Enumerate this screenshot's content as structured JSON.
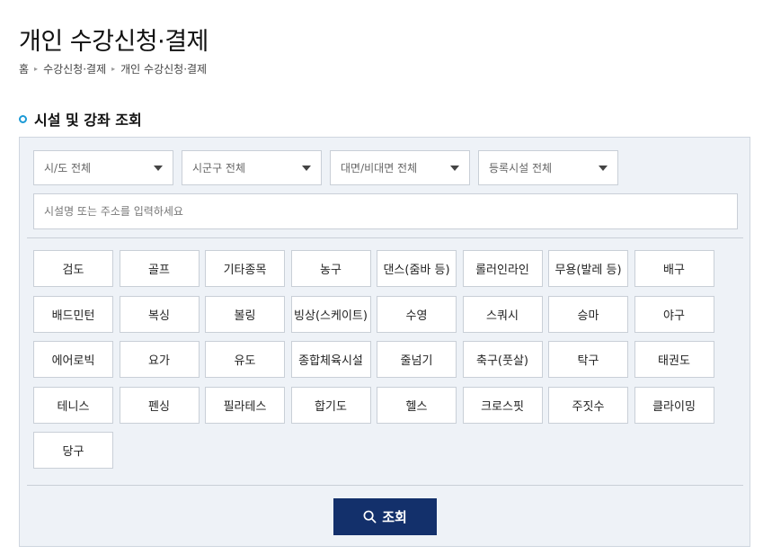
{
  "page": {
    "title": "개인 수강신청·결제"
  },
  "breadcrumb": {
    "items": [
      "홈",
      "수강신청·결제",
      "개인 수강신청·결제"
    ]
  },
  "section": {
    "title": "시설 및 강좌 조회"
  },
  "filters": {
    "selects": [
      "시/도 전체",
      "시군구 전체",
      "대면/비대면 전체",
      "등록시설 전체"
    ],
    "search_placeholder": "시설명 또는 주소를 입력하세요"
  },
  "sports": [
    "검도",
    "골프",
    "기타종목",
    "농구",
    "댄스(줌바 등)",
    "롤러인라인",
    "무용(발레 등)",
    "배구",
    "배드민턴",
    "복싱",
    "볼링",
    "빙상(스케이트)",
    "수영",
    "스쿼시",
    "승마",
    "야구",
    "에어로빅",
    "요가",
    "유도",
    "종합체육시설",
    "줄넘기",
    "축구(풋살)",
    "탁구",
    "태권도",
    "테니스",
    "펜싱",
    "필라테스",
    "합기도",
    "헬스",
    "크로스핏",
    "주짓수",
    "클라이밍",
    "당구"
  ],
  "submit": {
    "label": "조회",
    "icon": "search-icon"
  },
  "colors": {
    "accent": "#1c9ad6",
    "button_primary": "#13306b",
    "panel_bg": "#eef2f7"
  }
}
